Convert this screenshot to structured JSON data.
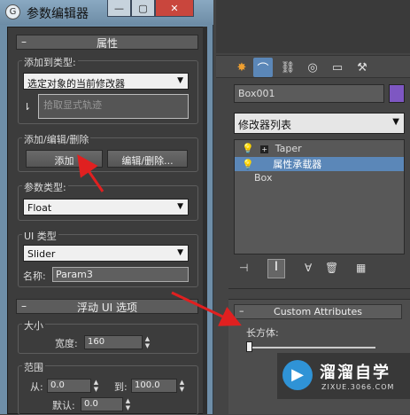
{
  "dialog": {
    "title": "参数编辑器",
    "attributes_rollout": {
      "header": "属性",
      "add_to_type_label": "添加到类型:",
      "add_to_type_value": "选定对象的当前修改器",
      "pick_track_placeholder": "拾取显式轨迹",
      "add_edit_delete_label": "添加/编辑/删除",
      "add_button": "添加",
      "edit_delete_button": "编辑/删除...",
      "param_type_label": "参数类型:",
      "param_type_value": "Float",
      "ui_type_label": "UI 类型",
      "ui_type_value": "Slider",
      "name_label": "名称:",
      "name_value": "Param3"
    },
    "float_ui_rollout": {
      "header": "浮动 UI 选项",
      "size_label": "大小",
      "width_label": "宽度:",
      "width_value": "160",
      "range_label": "范围",
      "from_label": "从:",
      "from_value": "0.0",
      "to_label": "到:",
      "to_value": "100.0",
      "default_label": "默认:",
      "default_value": "0.0"
    }
  },
  "command_panel": {
    "object_name": "Box001",
    "object_color": "#7e57c2",
    "modifier_list": "修改器列表",
    "stack": [
      {
        "label": "Taper",
        "highlight": false
      },
      {
        "label": "属性承载器",
        "highlight": true
      },
      {
        "label": "Box",
        "highlight": false
      }
    ],
    "custom_attributes": {
      "header": "Custom Attributes",
      "slider_label": "长方体:"
    }
  },
  "watermark": {
    "title": "溜溜自学",
    "url": "ZIXUE.3066.COM"
  }
}
